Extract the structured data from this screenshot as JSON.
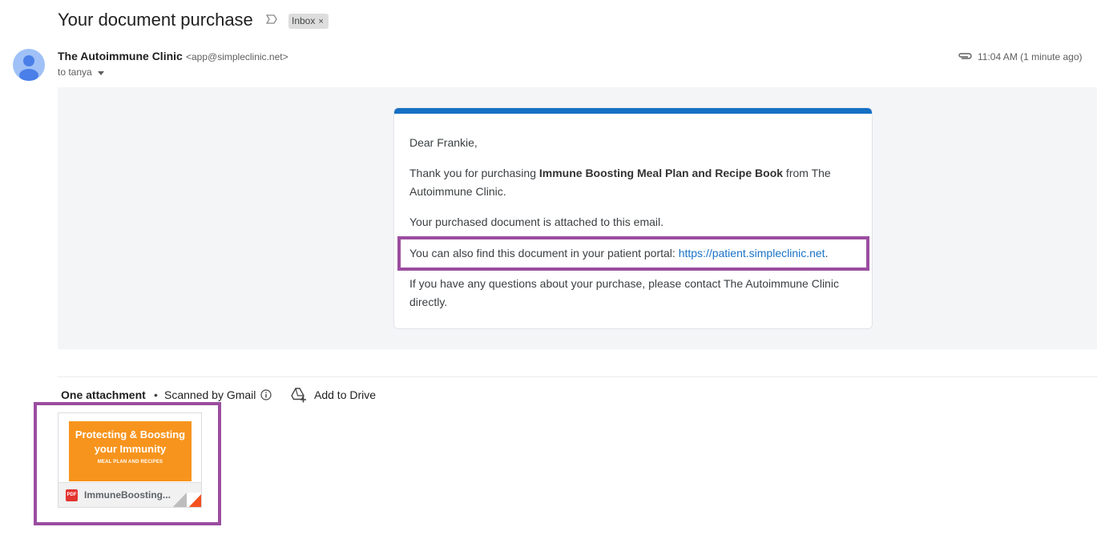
{
  "email": {
    "subject": "Your document purchase",
    "label": "Inbox",
    "label_remove": "×",
    "sender_name": "The Autoimmune Clinic",
    "sender_email": "<app@simpleclinic.net>",
    "to_line": "to tanya",
    "timestamp": "11:04 AM (1 minute ago)"
  },
  "message": {
    "greeting": "Dear Frankie,",
    "thanks_prefix": "Thank you for purchasing ",
    "product_name": "Immune Boosting Meal Plan and Recipe Book",
    "thanks_suffix": " from The Autoimmune Clinic.",
    "attached_note": "Your purchased document is attached to this email.",
    "portal_prefix": "You can also find this document in your patient portal: ",
    "portal_link": "https://patient.simpleclinic.net",
    "portal_suffix": ".",
    "questions": "If you have any questions about your purchase, please contact The Autoimmune Clinic directly."
  },
  "attachments": {
    "count_label": "One attachment",
    "separator": "•",
    "scanned_label": "Scanned by Gmail",
    "add_to_drive": "Add to Drive",
    "file": {
      "thumb_title": "Protecting & Boosting your Immunity",
      "thumb_subtitle": "MEAL PLAN AND RECIPES",
      "type_badge": "PDF",
      "name": "ImmuneBoosting..."
    }
  },
  "colors": {
    "accent_bar": "#1570c5",
    "link": "#1a73c8",
    "highlight": "#9b4da0",
    "thumbnail": "#f7941d",
    "pdf_badge": "#e3342f"
  },
  "icons": [
    "importance-marker-icon",
    "user-avatar-icon",
    "caret-down-icon",
    "paperclip-icon",
    "info-icon",
    "add-to-drive-icon",
    "pdf-icon"
  ]
}
